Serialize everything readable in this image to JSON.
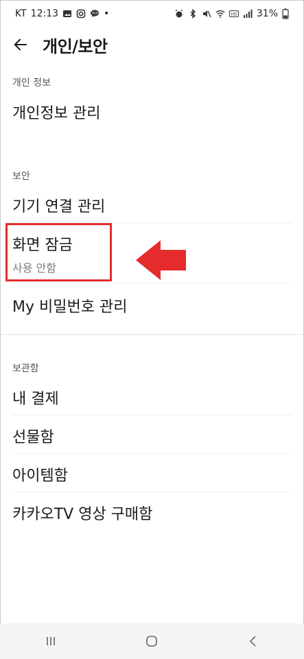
{
  "status_bar": {
    "carrier": "KT",
    "time": "12:13",
    "dot": "•",
    "battery": "31%",
    "icons_left": [
      "image-icon",
      "instagram-icon",
      "talk-icon"
    ],
    "icons_right": [
      "alarm-icon",
      "bluetooth-icon",
      "mute-icon",
      "wifi-icon",
      "hd-icon",
      "signal-icon",
      "battery-icon"
    ]
  },
  "header": {
    "title": "개인/보안",
    "back_icon": "arrow-left-icon"
  },
  "sections": {
    "personal": {
      "header": "개인 정보",
      "items": [
        {
          "label": "개인정보 관리"
        }
      ]
    },
    "security": {
      "header": "보안",
      "items": [
        {
          "label": "기기 연결 관리"
        },
        {
          "label": "화면 잠금",
          "sublabel": "사용 안함"
        },
        {
          "label": "My 비밀번호 관리"
        }
      ]
    },
    "storage": {
      "header": "보관함",
      "items": [
        {
          "label": "내 결제"
        },
        {
          "label": "선물함"
        },
        {
          "label": "아이템함"
        },
        {
          "label": "카카오TV 영상 구매함"
        }
      ]
    }
  },
  "annotation": {
    "highlight_color": "#e52b2b",
    "arrow_color": "#e52b2b"
  },
  "nav_bar": {
    "icons": [
      "recent-apps-icon",
      "home-icon",
      "back-icon"
    ]
  }
}
